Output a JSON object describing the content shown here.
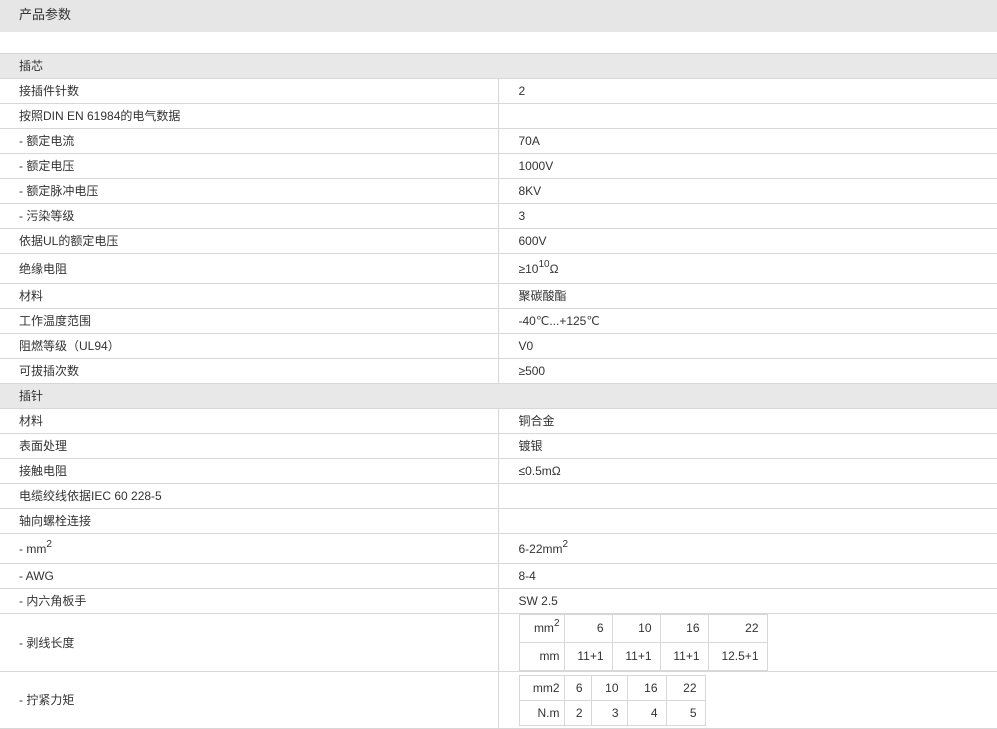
{
  "page_title": "产品参数",
  "sections": [
    {
      "title": "插芯",
      "rows": [
        {
          "label": "接插件针数",
          "value": "2"
        },
        {
          "label": "按照DIN EN 61984的电气数据",
          "value": ""
        },
        {
          "label": "- 额定电流",
          "value": "70A"
        },
        {
          "label": "- 额定电压",
          "value": "1000V"
        },
        {
          "label": "- 额定脉冲电压",
          "value": "8KV"
        },
        {
          "label": "- 污染等级",
          "value": "3"
        },
        {
          "label": "依据UL的额定电压",
          "value": "600V"
        },
        {
          "label": "绝缘电阻",
          "value_prefix": "≥10",
          "value_sup": "10",
          "value_suffix": "Ω"
        },
        {
          "label": "材料",
          "value": "聚碳酸酯"
        },
        {
          "label": "工作温度范围",
          "value": "-40℃...+125℃"
        },
        {
          "label": "阻燃等级（UL94）",
          "value": "V0"
        },
        {
          "label": "可拔插次数",
          "value": "≥500"
        }
      ]
    },
    {
      "title": "插针",
      "rows": [
        {
          "label": "材料",
          "value": "铜合金"
        },
        {
          "label": "表面处理",
          "value": "镀银"
        },
        {
          "label": "接触电阻",
          "value": "≤0.5mΩ"
        },
        {
          "label": "电缆绞线依据IEC 60 228-5",
          "value": ""
        },
        {
          "label": "轴向螺栓连接",
          "value": ""
        },
        {
          "label_prefix": "- mm",
          "label_sup": "2",
          "value_prefix": "6-22mm",
          "value_sup": "2"
        },
        {
          "label": "- AWG",
          "value": "8-4"
        },
        {
          "label": "- 内六角板手",
          "value": "SW 2.5"
        }
      ]
    }
  ],
  "strip_length": {
    "label": "- 剥线长度",
    "header_prefix": "mm",
    "header_sup": "2",
    "row_unit": "mm",
    "sizes": [
      "6",
      "10",
      "16",
      "22"
    ],
    "lengths": [
      "11+1",
      "11+1",
      "11+1",
      "12.5+1"
    ]
  },
  "torque": {
    "label": "- 拧紧力矩",
    "header": "mm2",
    "row_unit": "N.m",
    "sizes": [
      "6",
      "10",
      "16",
      "22"
    ],
    "values": [
      "2",
      "3",
      "4",
      "5"
    ]
  }
}
